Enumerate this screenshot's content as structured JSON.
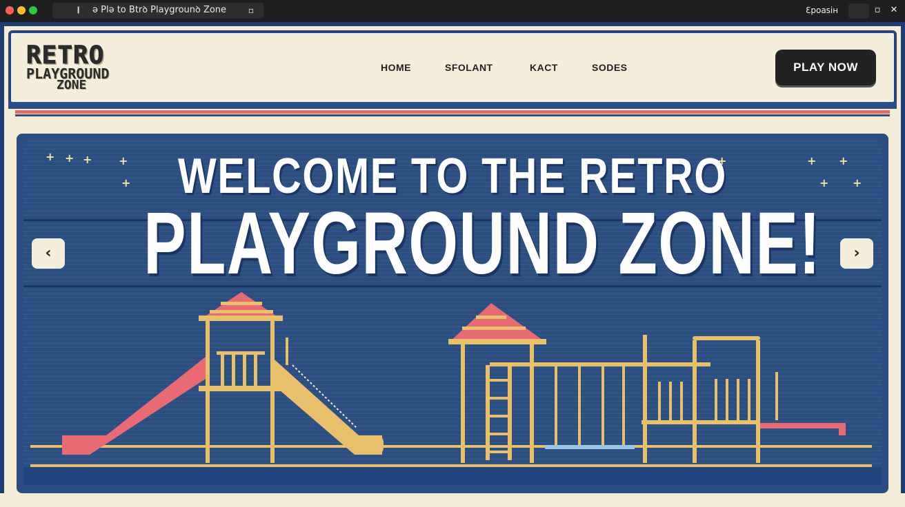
{
  "window": {
    "tab_glyph": "❙",
    "tab_title": "ǝ Plə to  Btrꝺ Playgrounꝺ Zone",
    "user_label": "Ɛpoasiн",
    "restore_glyph": "▫",
    "close_glyph": "✕"
  },
  "header": {
    "logo": {
      "line1": "RETRO",
      "line2": "PLAYGROUND",
      "line3": "ZONE"
    },
    "nav": [
      {
        "label": "HOME"
      },
      {
        "label": "SFOLANT"
      },
      {
        "label": "KACT"
      },
      {
        "label": "SODES"
      }
    ],
    "cta_label": "PLAY NOW"
  },
  "hero": {
    "title_line1": "WELCOME TO THE RETRO",
    "title_line2": "PLAYGROUND ZONE!",
    "prev_glyph": "‹",
    "next_glyph": "›",
    "sparkle_glyph": "+"
  },
  "colors": {
    "background": "#f3ecd6",
    "navy": "#2c4f82",
    "border_navy": "#23457e",
    "accent_red": "#e56a66",
    "wood": "#e8bf6a",
    "slide": "#e86a72",
    "button_dark": "#222222"
  },
  "icons": {
    "prev": "chevron-left-icon",
    "next": "chevron-right-icon",
    "close": "close-icon"
  }
}
